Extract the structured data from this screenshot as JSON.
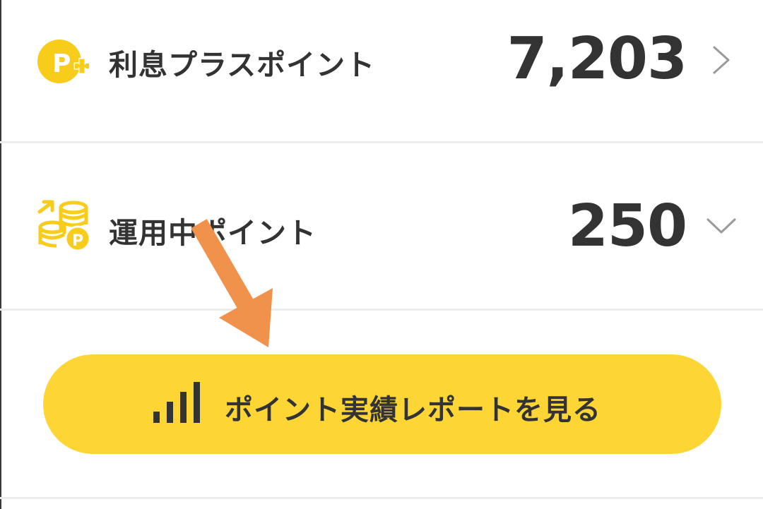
{
  "points": {
    "plus": {
      "icon": "point-plus-icon",
      "label": "利息プラスポイント",
      "value": "7,203",
      "chevron": "chevron-right-icon"
    },
    "invested": {
      "icon": "coins-invest-icon",
      "label": "運用中ポイント",
      "value": "250",
      "chevron": "chevron-down-icon"
    }
  },
  "report_button": {
    "icon": "bar-chart-icon",
    "label": "ポイント実績レポートを見る"
  },
  "annotation": {
    "icon": "pointer-arrow",
    "color": "#f0924b"
  },
  "colors": {
    "accent_yellow": "#fdd535",
    "icon_yellow": "#f8cc1b",
    "text": "#333333",
    "chevron": "#9a9a9a",
    "divider": "#ececec"
  }
}
